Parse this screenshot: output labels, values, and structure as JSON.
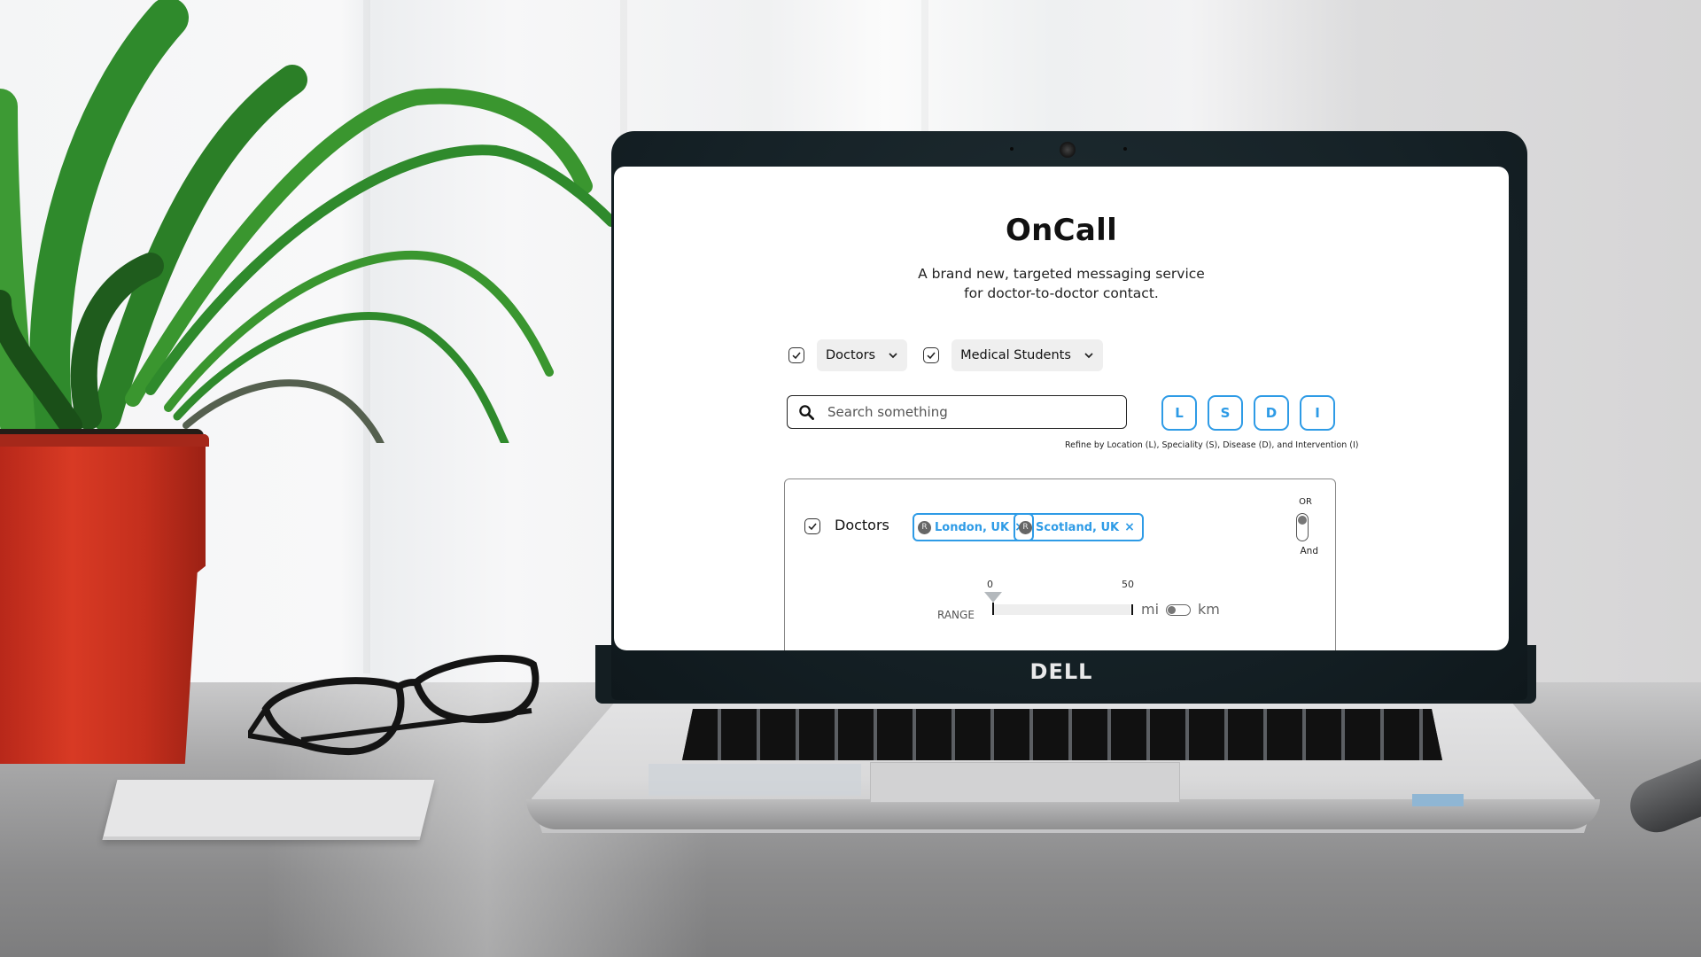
{
  "scene": {
    "laptop_brand": "DELL"
  },
  "app": {
    "title": "OnCall",
    "subtitle_line1": "A brand new, targeted messaging service",
    "subtitle_line2": "for doctor-to-doctor contact.",
    "audience_filters": [
      {
        "label": "Doctors",
        "checked": true
      },
      {
        "label": "Medical Students",
        "checked": true
      }
    ],
    "search": {
      "placeholder": "Search something",
      "value": ""
    },
    "refine_buttons": [
      {
        "label": "L",
        "meaning": "Location"
      },
      {
        "label": "S",
        "meaning": "Speciality"
      },
      {
        "label": "D",
        "meaning": "Disease"
      },
      {
        "label": "I",
        "meaning": "Intervention"
      }
    ],
    "refine_hint": "Refine by Location (L), Speciality (S), Disease (D), and Intervention (I)",
    "accent_color": "#2e9be6",
    "panel": {
      "group_label": "Doctors",
      "group_checked": true,
      "chips": [
        {
          "badge": "R",
          "label": "London, UK",
          "remove": "×"
        },
        {
          "badge": "R",
          "label": "Scotland, UK",
          "remove": "×"
        }
      ],
      "logic_toggle": {
        "top_label": "OR",
        "bottom_label": "And",
        "selected": "OR"
      },
      "range": {
        "label": "RANGE",
        "min_label": "0",
        "max_label": "50",
        "value": 0,
        "unit_left": "mi",
        "unit_right": "km",
        "selected_unit": "mi"
      }
    }
  }
}
